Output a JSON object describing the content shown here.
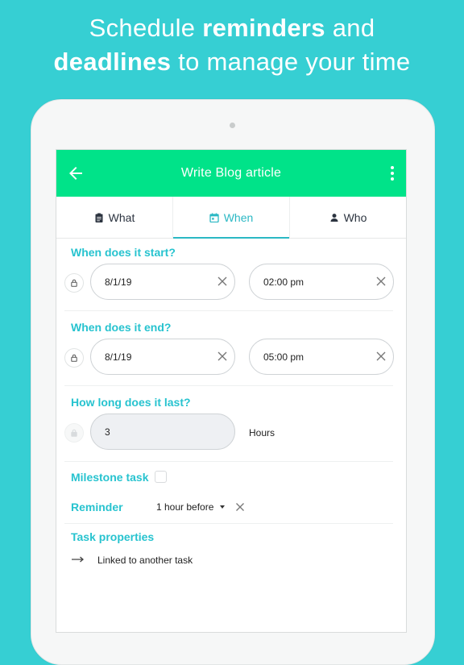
{
  "headline": {
    "line1_pre": "Schedule ",
    "line1_bold": "reminders",
    "line1_post": " and",
    "line2_bold": "deadlines",
    "line2_post": " to manage your time"
  },
  "appbar": {
    "title": "Write Blog article"
  },
  "tabs": [
    {
      "label": "What",
      "icon": "clipboard-icon",
      "active": false
    },
    {
      "label": "When",
      "icon": "calendar-icon",
      "active": true
    },
    {
      "label": "Who",
      "icon": "person-icon",
      "active": false
    }
  ],
  "start": {
    "label": "When does it start?",
    "date": "8/1/19",
    "time": "02:00 pm"
  },
  "end": {
    "label": "When does it end?",
    "date": "8/1/19",
    "time": "05:00 pm"
  },
  "duration": {
    "label": "How long does it last?",
    "value": "3",
    "unit": "Hours"
  },
  "milestone": {
    "label": "Milestone task",
    "checked": false
  },
  "reminder": {
    "label": "Reminder",
    "value": "1 hour before"
  },
  "properties": {
    "label": "Task properties",
    "linked": "Linked to another task"
  },
  "colors": {
    "accent": "#27c3cf",
    "appbar": "#00e389",
    "background": "#36cfd3"
  }
}
